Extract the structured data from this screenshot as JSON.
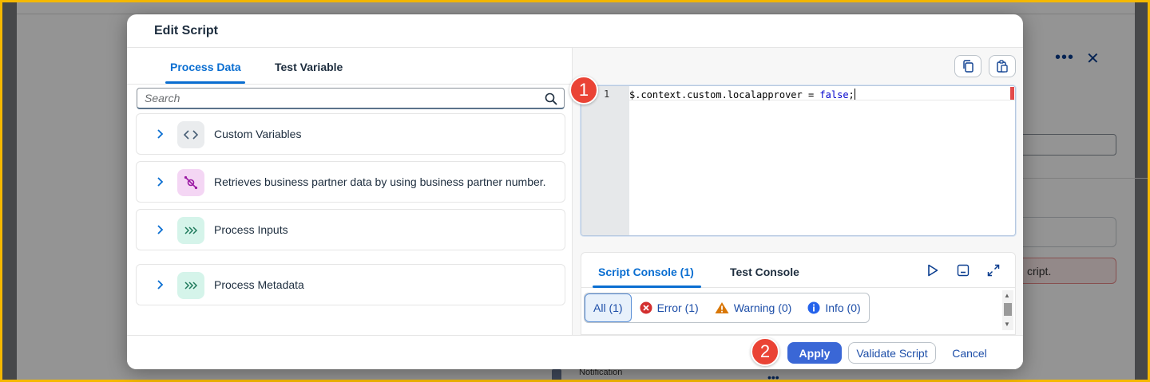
{
  "background": {
    "error_text": "cript.",
    "notification_label": "Notification"
  },
  "dialog": {
    "title": "Edit Script"
  },
  "left_panel": {
    "tabs": [
      {
        "label": "Process Data",
        "active": true
      },
      {
        "label": "Test Variable",
        "active": false
      }
    ],
    "search": {
      "placeholder": "Search",
      "value": ""
    },
    "items": [
      {
        "label": "Custom Variables",
        "icon": "code-brackets-icon"
      },
      {
        "label": "Retrieves business partner data by using business partner number.",
        "icon": "pipeline-link-icon"
      },
      {
        "label": "Process Inputs",
        "icon": "chevrons-right-icon"
      },
      {
        "label": "Process Metadata",
        "icon": "chevrons-right-icon"
      }
    ]
  },
  "editor": {
    "line_number": "1",
    "code_before": "$.context.custom.localapprover = ",
    "code_keyword": "false",
    "code_after": ";"
  },
  "console": {
    "tabs": [
      {
        "label": "Script Console (1)",
        "active": true
      },
      {
        "label": "Test Console",
        "active": false
      }
    ],
    "filters": [
      {
        "label": "All (1)",
        "active": true
      },
      {
        "label": "Error (1)",
        "icon": "error-icon"
      },
      {
        "label": "Warning (0)",
        "icon": "warning-icon"
      },
      {
        "label": "Info (0)",
        "icon": "info-icon"
      }
    ]
  },
  "footer": {
    "apply_label": "Apply",
    "validate_label": "Validate Script",
    "cancel_label": "Cancel"
  },
  "markers": [
    "1",
    "2"
  ],
  "colors": {
    "accent": "#0a6ed1",
    "primary_button": "#3a67d6",
    "marker": "#ea4335",
    "error": "#d32f2f",
    "warning": "#d97706",
    "info": "#2563eb"
  }
}
